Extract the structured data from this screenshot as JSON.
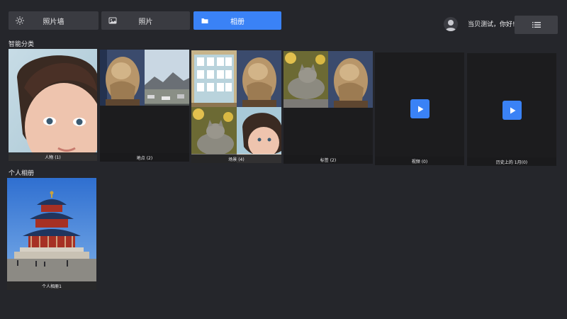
{
  "tabs": [
    {
      "label": "照片墙",
      "icon": "sun-icon",
      "active": false
    },
    {
      "label": "照片",
      "icon": "image-icon",
      "active": false
    },
    {
      "label": "相册",
      "icon": "folder-icon",
      "active": true
    }
  ],
  "user": {
    "greeting": "当贝测试，你好!",
    "icon": "user-avatar-icon"
  },
  "menu": {
    "icon": "list-menu-icon"
  },
  "sections": {
    "smart": {
      "title": "智能分类"
    },
    "personal": {
      "title": "个人相册"
    }
  },
  "smart_albums": [
    {
      "caption": "人物 (1)"
    },
    {
      "caption": "地点 (2)"
    },
    {
      "caption": "场景 (4)"
    },
    {
      "caption": "标签 (2)"
    },
    {
      "caption": "视频 (0)"
    },
    {
      "caption": "历史上的 1月(0)"
    }
  ],
  "personal_albums": [
    {
      "caption": "个人相册1"
    }
  ],
  "colors": {
    "accent": "#3a82f6",
    "background": "#25262b",
    "tab": "#3a3b41"
  }
}
